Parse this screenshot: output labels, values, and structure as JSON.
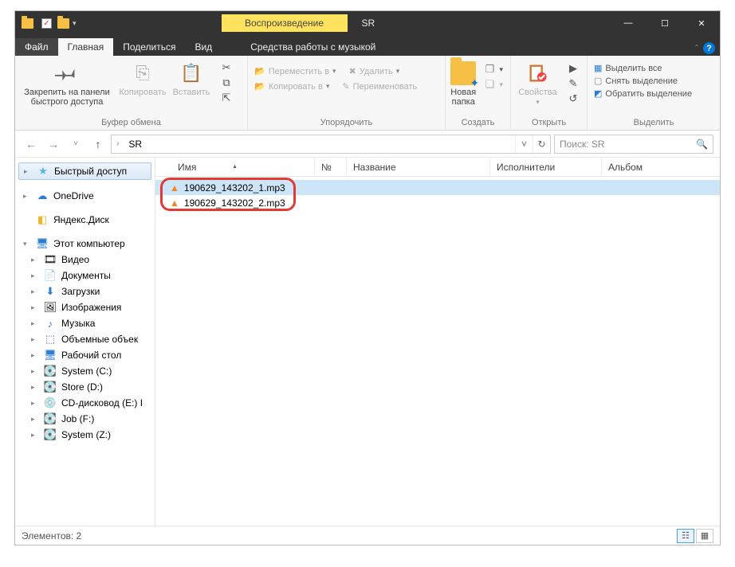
{
  "titlebar": {
    "context_tab": "Воспроизведение",
    "title": "SR",
    "minimize": "—",
    "maximize": "☐",
    "close": "✕"
  },
  "tabs": {
    "file": "Файл",
    "home": "Главная",
    "share": "Поделиться",
    "view": "Вид",
    "music": "Средства работы с музыкой"
  },
  "ribbon": {
    "clipboard": {
      "pin": "Закрепить на панели быстрого доступа",
      "copy": "Копировать",
      "paste": "Вставить",
      "cut": "Вырезать",
      "copy_path": "Скопировать путь",
      "paste_shortcut": "Вставить ярлык",
      "group": "Буфер обмена"
    },
    "organize": {
      "move_to": "Переместить в",
      "copy_to": "Копировать в",
      "delete": "Удалить",
      "rename": "Переименовать",
      "group": "Упорядочить"
    },
    "new": {
      "new_folder": "Новая папка",
      "new_item": "Создать элемент",
      "easy_access": "Простой доступ",
      "group": "Создать"
    },
    "open": {
      "properties": "Свойства",
      "open": "Открыть",
      "edit": "Изменить",
      "history": "Журнал",
      "group": "Открыть"
    },
    "select": {
      "select_all": "Выделить все",
      "select_none": "Снять выделение",
      "invert": "Обратить выделение",
      "group": "Выделить"
    }
  },
  "addr": {
    "crumb1": "SR",
    "refresh": "↻",
    "dropdown": "˅"
  },
  "search": {
    "placeholder": "Поиск: SR"
  },
  "sidebar": {
    "quick": "Быстрый доступ",
    "onedrive": "OneDrive",
    "yandex": "Яндекс.Диск",
    "this_pc": "Этот компьютер",
    "video": "Видео",
    "docs": "Документы",
    "downloads": "Загрузки",
    "pictures": "Изображения",
    "music": "Музыка",
    "volumes": "Объемные объек",
    "desktop": "Рабочий стол",
    "c": "System (C:)",
    "d": "Store (D:)",
    "e": "CD-дисковод (E:) I",
    "f": "Job (F:)",
    "z": "System (Z:)"
  },
  "columns": {
    "name": "Имя",
    "num": "№",
    "title": "Название",
    "artists": "Исполнители",
    "album": "Альбом"
  },
  "files": [
    {
      "name": "190629_143202_1.mp3"
    },
    {
      "name": "190629_143202_2.mp3"
    }
  ],
  "status": {
    "count": "Элементов: 2"
  }
}
